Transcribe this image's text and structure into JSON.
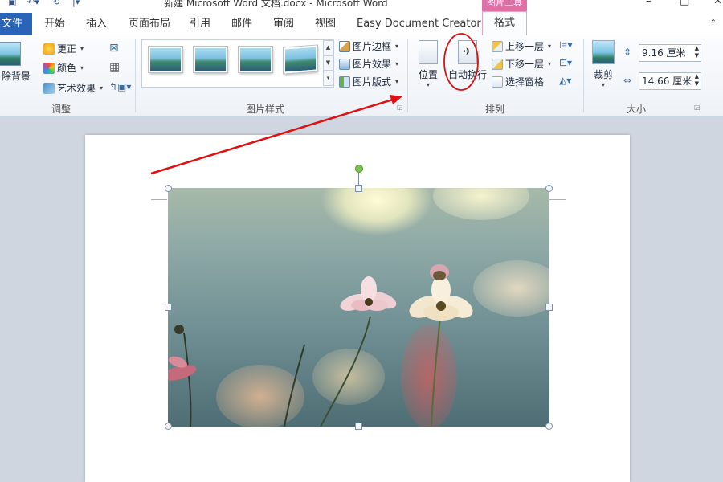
{
  "window": {
    "title": "新建 Microsoft Word 文档.docx  -  Microsoft Word",
    "context_tool": "图片工具"
  },
  "tabs": {
    "file": "文件",
    "items": [
      "开始",
      "插入",
      "页面布局",
      "引用",
      "邮件",
      "审阅",
      "视图",
      "Easy Document Creator"
    ],
    "active": "格式"
  },
  "ribbon": {
    "adjust": {
      "remove_bg": "除背景",
      "corrections": "更正",
      "color": "颜色",
      "artistic": "艺术效果",
      "label": "调整"
    },
    "styles": {
      "border": "图片边框",
      "effects": "图片效果",
      "layout": "图片版式",
      "label": "图片样式"
    },
    "arrange": {
      "position": "位置",
      "wrap": "自动换行",
      "bring_forward": "上移一层",
      "send_backward": "下移一层",
      "selection_pane": "选择窗格",
      "label": "排列"
    },
    "size": {
      "crop": "裁剪",
      "height": "9.16 厘米",
      "width": "14.66 厘米",
      "label": "大小"
    }
  },
  "colors": {
    "file_tab": "#2a64b8",
    "context_tab": "#e06fa6",
    "annotation": "#e01010",
    "rotate_handle": "#79c24c"
  }
}
